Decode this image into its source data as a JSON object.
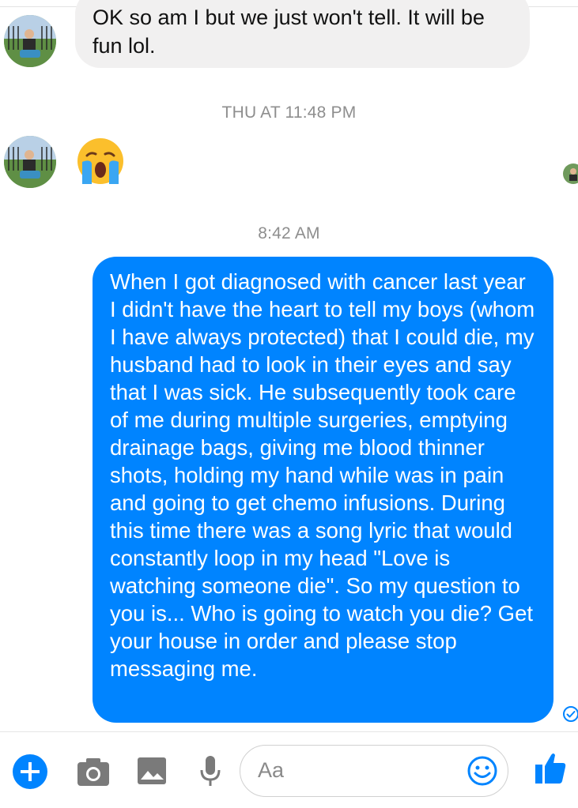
{
  "thread": {
    "incoming_message": "OK so am I but we just won't tell. It will be fun lol.",
    "timestamp_1": "THU AT 11:48 PM",
    "incoming_emoji": "crying-face-emoji",
    "timestamp_2": "8:42 AM",
    "outgoing_message": "When I got diagnosed with cancer last year I didn't have the heart to tell my boys (whom I have always protected) that I could die, my husband had to look in their eyes and say that I was sick. He subsequently took care of me during multiple surgeries, emptying drainage bags, giving me blood thinner shots, holding my hand while was in pain and going to get chemo infusions. During this time there was a song lyric that would constantly loop in my head \"Love is watching someone die\". So my question to you is... Who is going to watch you die? Get your house in order and please stop messaging me."
  },
  "composer": {
    "placeholder": "Aa",
    "icons": [
      "plus-icon",
      "camera-icon",
      "gallery-icon",
      "microphone-icon",
      "emoji-icon",
      "thumbs-up-icon"
    ]
  },
  "colors": {
    "accent": "#0084ff",
    "incoming_bubble": "#f1f0f0",
    "timestamp": "#8e8e8e"
  }
}
